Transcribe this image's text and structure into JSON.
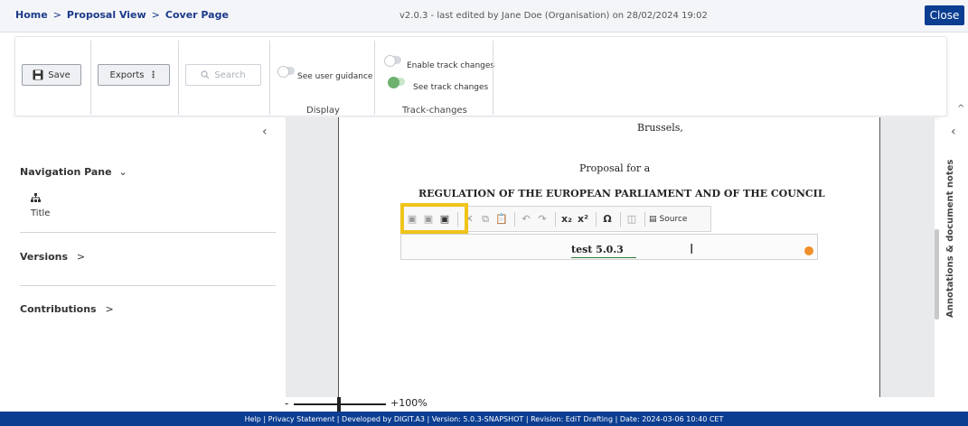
{
  "header": {
    "breadcrumb": [
      "Home",
      "Proposal View",
      "Cover Page"
    ],
    "separator": ">",
    "version_info": "v2.0.3 - last edited by Jane Doe (Organisation) on 28/02/2024 19:02",
    "close_label": "Close"
  },
  "toolbar": {
    "save_label": "Save",
    "exports_label": "Exports",
    "search_label": "Search",
    "see_user_guidance": "See user guidance",
    "display_label": "Display",
    "enable_track_changes": "Enable track changes",
    "see_track_changes": "See track changes",
    "track_changes_label": "Track-changes"
  },
  "navigation": {
    "pane_title": "Navigation Pane",
    "title_item": "Title",
    "versions": "Versions",
    "contributions": "Contributions"
  },
  "document": {
    "city": "Brussels,",
    "proposal_for": "Proposal for a",
    "regulation_title": "REGULATION OF THE EUROPEAN PARLIAMENT AND OF THE COUNCIL",
    "editable_text": "test 5.0.3",
    "source_label": "Source"
  },
  "side_panel": {
    "annotations_label": "Annotations & document notes"
  },
  "zoom": {
    "minus": "-",
    "level": "+100%"
  },
  "footer": {
    "text": "Help | Privacy Statement | Developed by DIGIT.A3 | Version: 5.0.3-SNAPSHOT | Revision: EdiT Drafting | Date: 2024-03-06 10:40 CET"
  },
  "colors": {
    "brand": "#0b3d91",
    "highlight": "#f0c419",
    "dot": "#f0902c"
  }
}
